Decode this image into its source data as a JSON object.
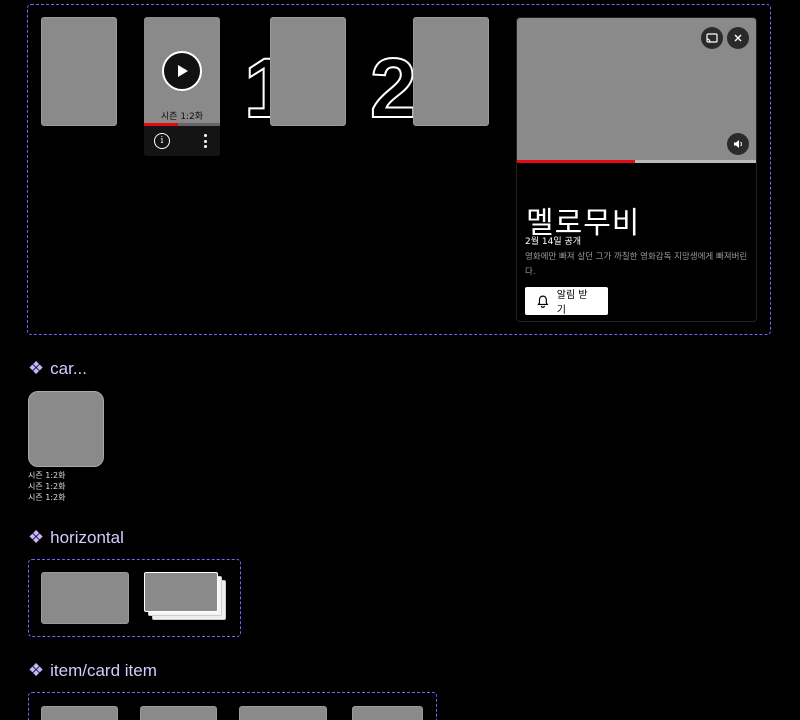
{
  "top_frame": {
    "hover_card": {
      "episode_label": "시즌 1:2화",
      "progress": 0.45
    },
    "rank_numbers": [
      "1",
      "2"
    ],
    "preview": {
      "title": "멜로무비",
      "release": "2월 14일 공개",
      "description": "영화에만 빠져 살던 그가 까칠한 영화감독 지망생에게 빠져버린다.",
      "notify_label": "알림 받기",
      "progress": 0.49,
      "icons": {
        "cast": "cast-icon",
        "close": "close-icon",
        "volume": "volume-icon"
      }
    }
  },
  "section_car": {
    "title": "car...",
    "lines": [
      "시즌 1:2화",
      "시즌 1:2화",
      "시즌 1:2화"
    ]
  },
  "section_horizontal": {
    "title": "horizontal"
  },
  "section_card_item": {
    "title": "item/card item"
  },
  "colors": {
    "accent_red": "#e50914",
    "frame_purple": "#7b61ff",
    "placeholder_gray": "#8a8a8a"
  }
}
